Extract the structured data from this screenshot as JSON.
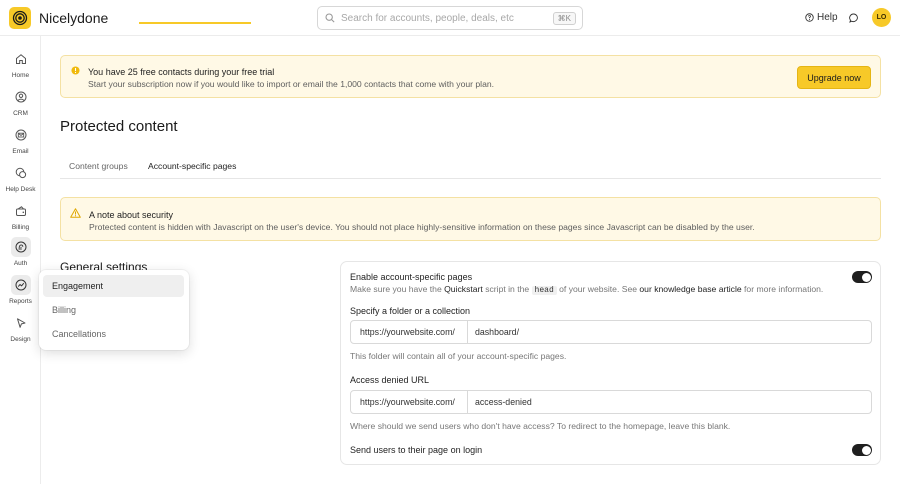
{
  "app": {
    "name": "Nicelydone",
    "avatar_initials": "LO"
  },
  "search": {
    "placeholder": "Search for accounts, people, deals, etc",
    "shortcut": "⌘K"
  },
  "header": {
    "help_label": "Help"
  },
  "sidebar": {
    "items": [
      {
        "label": "Home",
        "icon": "home-icon"
      },
      {
        "label": "CRM",
        "icon": "user-circle-icon"
      },
      {
        "label": "Email",
        "icon": "mail-icon"
      },
      {
        "label": "Help Desk",
        "icon": "chat-bubbles-icon"
      },
      {
        "label": "Billing",
        "icon": "wallet-icon"
      },
      {
        "label": "Auth",
        "icon": "fingerprint-icon",
        "active": true
      },
      {
        "label": "Reports",
        "icon": "chart-icon",
        "active": true
      },
      {
        "label": "Design",
        "icon": "cursor-icon"
      }
    ]
  },
  "reports_menu": {
    "items": [
      "Engagement",
      "Billing",
      "Cancellations"
    ],
    "active": "Engagement"
  },
  "trial_banner": {
    "title": "You have 25 free contacts during your free trial",
    "body": "Start your subscription now if you would like to import or email the 1,000 contacts that come with your plan.",
    "button": "Upgrade now"
  },
  "page": {
    "title": "Protected content"
  },
  "tabs": [
    {
      "label": "Content groups",
      "active": false
    },
    {
      "label": "Account-specific pages",
      "active": true
    }
  ],
  "security_note": {
    "title": "A note about security",
    "body": "Protected content is hidden with Javascript on the user's device. You should not place highly-sensitive information on these pages since Javascript can be disabled by the user."
  },
  "general_settings": {
    "title": "General settings",
    "enable": {
      "label": "Enable account-specific pages",
      "desc_1": "Make sure you have the",
      "desc_bold_1": "Quickstart",
      "desc_2": "script in the",
      "desc_code": "head",
      "desc_3": "of your website. See",
      "desc_link": "our knowledge base article",
      "desc_4": "for more information.",
      "enabled": true
    },
    "folder": {
      "label": "Specify a folder or a collection",
      "prefix": "https://yourwebsite.com/",
      "value": "dashboard/",
      "help": "This folder will contain all of your account-specific pages."
    },
    "access_denied": {
      "label": "Access denied URL",
      "prefix": "https://yourwebsite.com/",
      "value": "access-denied",
      "help": "Where should we send users who don't have access? To redirect to the homepage, leave this blank."
    },
    "login_redirect": {
      "label": "Send users to their page on login",
      "enabled": true
    }
  },
  "colors": {
    "accent": "#f7c928",
    "banner_bg": "#fff9e6",
    "banner_border": "#f4e1a3",
    "toggle_on": "#1f1f1f"
  }
}
